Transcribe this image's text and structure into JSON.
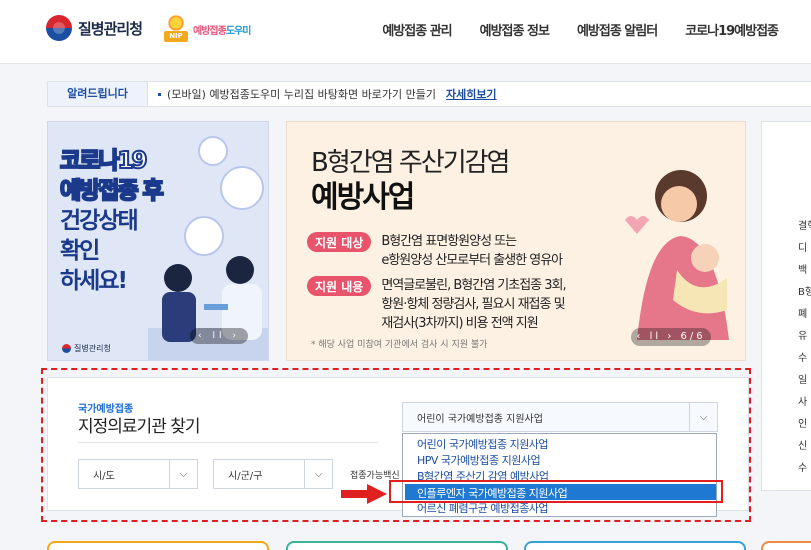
{
  "header": {
    "org_name": "질병관리청",
    "service_name_a": "예방접종",
    "service_name_b": "도우미",
    "nip_badge": "NIP",
    "nav": [
      "예방접종 관리",
      "예방접종 정보",
      "예방접종 알림터",
      "코로나19예방접종"
    ]
  },
  "notice": {
    "tag": "알려드립니다",
    "text": "(모바일) 예방접종도우미 누리집 바탕화면 바로가기 만들기",
    "more": "자세히보기"
  },
  "banner_left": {
    "title_line1": "코로나19",
    "title_line2": "예방접종 후",
    "title_line3": "건강상태",
    "title_line4": "확인",
    "title_line5": "하세요!",
    "footer": "질병관리청",
    "pager": "‹ ll ›"
  },
  "banner_main": {
    "title1": "B형간염 주산기감염",
    "title2": "예방사업",
    "tag1": "지원 대상",
    "desc1": "B형간염 표면항원양성 또는\ne항원양성 산모로부터 출생한 영유아",
    "tag2": "지원 내용",
    "desc2": "면역글로불린, B형간염 기초접종 3회,\n항원·항체 정량검사, 필요시 재접종 및\n재검사(3차까지) 비용 전액 지원",
    "note": "* 해당 사업 미참여 기관에서 검사 시 지원 불가",
    "pager": "‹ ll › 6/6"
  },
  "banner_right": {
    "items": [
      "결핵",
      "디",
      "백",
      "B형",
      "폐",
      "유",
      "수",
      "일",
      "사",
      "인",
      "신",
      "수"
    ]
  },
  "search": {
    "subtitle": "국가예방접종",
    "title": "지정의료기관 찾기",
    "program_select": "어린이 국가예방접종 지원사업",
    "sido": "시/도",
    "sigungu": "시/군/구",
    "vaccine": "접종가능백신",
    "options": [
      "어린이 국가예방접종 지원사업",
      "HPV 국가예방접종 지원사업",
      "B형간염 주산기 감염 예방사업",
      "인플루엔자 국가예방접종 지원사업",
      "어르신 폐렴구균 예방접종사업"
    ],
    "highlighted_index": 3
  },
  "colors": {
    "accent": "#1c4ea1",
    "highlight": "#1f78d1",
    "annotation_red": "#e02020",
    "tag_pink": "#e8546b"
  }
}
